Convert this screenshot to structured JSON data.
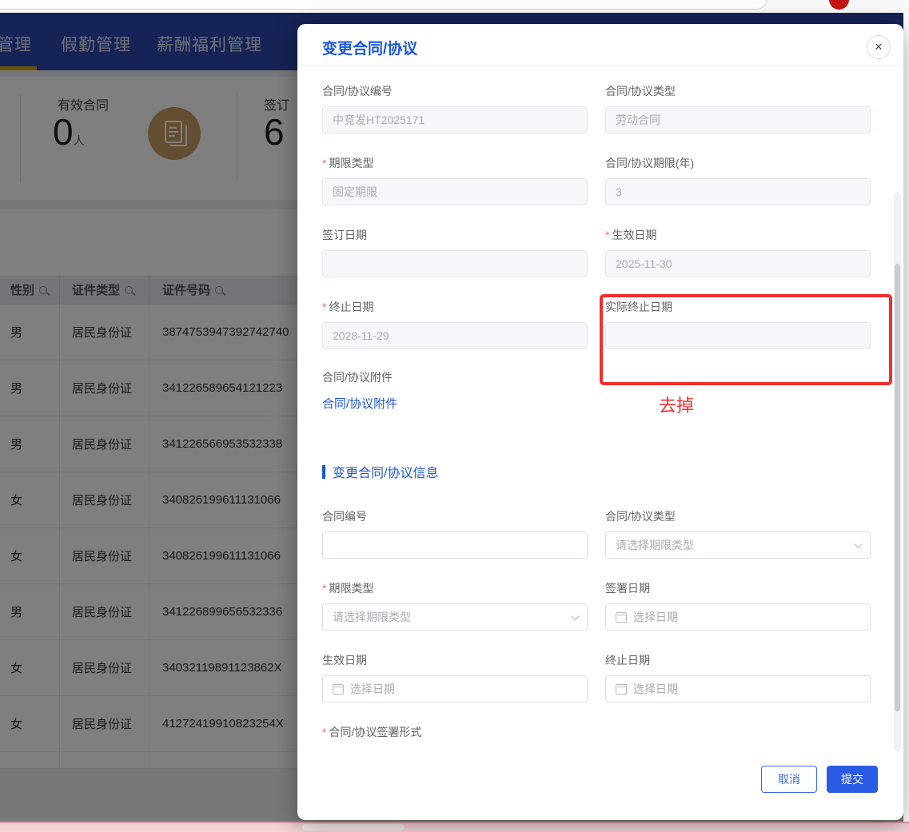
{
  "colors": {
    "accent_blue": "#1a56db",
    "nav_blue": "#2a47ad",
    "active_tab_gold": "#d2a410",
    "annotation_red": "#f12f2f",
    "stat_icon_tan": "#c89c62",
    "bottom_bar_pink": "#f1cbcf"
  },
  "icons": {
    "close": "✕"
  },
  "nav": {
    "tabs": [
      "管理",
      "假勤管理",
      "薪酬福利管理"
    ]
  },
  "stats": {
    "valid": {
      "label": "有效合同",
      "value": "0",
      "unit": "人"
    },
    "signed": {
      "label": "签订",
      "value": "6"
    }
  },
  "table": {
    "columns": [
      "性别",
      "证件类型",
      "证件号码"
    ],
    "rows": [
      [
        "男",
        "居民身份证",
        "3874753947392742740"
      ],
      [
        "男",
        "居民身份证",
        "341226589654121223"
      ],
      [
        "男",
        "居民身份证",
        "341226566953532338"
      ],
      [
        "女",
        "居民身份证",
        "340826199611131066"
      ],
      [
        "女",
        "居民身份证",
        "340826199611131066"
      ],
      [
        "男",
        "居民身份证",
        "341226899656532336"
      ],
      [
        "女",
        "居民身份证",
        "34032119891123862X"
      ],
      [
        "女",
        "居民身份证",
        "41272419910823254X"
      ]
    ]
  },
  "modal": {
    "title": "变更合同/协议",
    "required_mark": "*",
    "original": {
      "contract_no": {
        "label": "合同/协议编号",
        "value": "中竞发HT2025171"
      },
      "contract_type": {
        "label": "合同/协议类型",
        "value": "劳动合同"
      },
      "term_type": {
        "label": "期限类型",
        "value": "固定期限"
      },
      "term_years": {
        "label": "合同/协议期限(年)",
        "value": "3"
      },
      "sign_date": {
        "label": "签订日期",
        "value": ""
      },
      "effective_date": {
        "label": "生效日期",
        "value": "2025-11-30"
      },
      "end_date": {
        "label": "终止日期",
        "value": "2028-11-29"
      },
      "actual_end_date": {
        "label": "实际终止日期",
        "value": ""
      }
    },
    "attachment": {
      "label": "合同/协议附件",
      "link_text": "合同/协议附件"
    },
    "annotation": {
      "text": "去掉"
    },
    "change_section": {
      "title": "变更合同/协议信息",
      "contract_no": {
        "label": "合同编号",
        "value": ""
      },
      "contract_type": {
        "label": "合同/协议类型",
        "placeholder": "请选择期限类型"
      },
      "term_type": {
        "label": "期限类型",
        "placeholder": "请选择期限类型"
      },
      "sign_date": {
        "label": "签署日期",
        "placeholder": "选择日期"
      },
      "effective_date": {
        "label": "生效日期",
        "placeholder": "选择日期"
      },
      "end_date": {
        "label": "终止日期",
        "placeholder": "选择日期"
      },
      "sign_form": {
        "label": "合同/协议签署形式"
      }
    },
    "footer": {
      "cancel": "取消",
      "submit": "提交"
    }
  }
}
